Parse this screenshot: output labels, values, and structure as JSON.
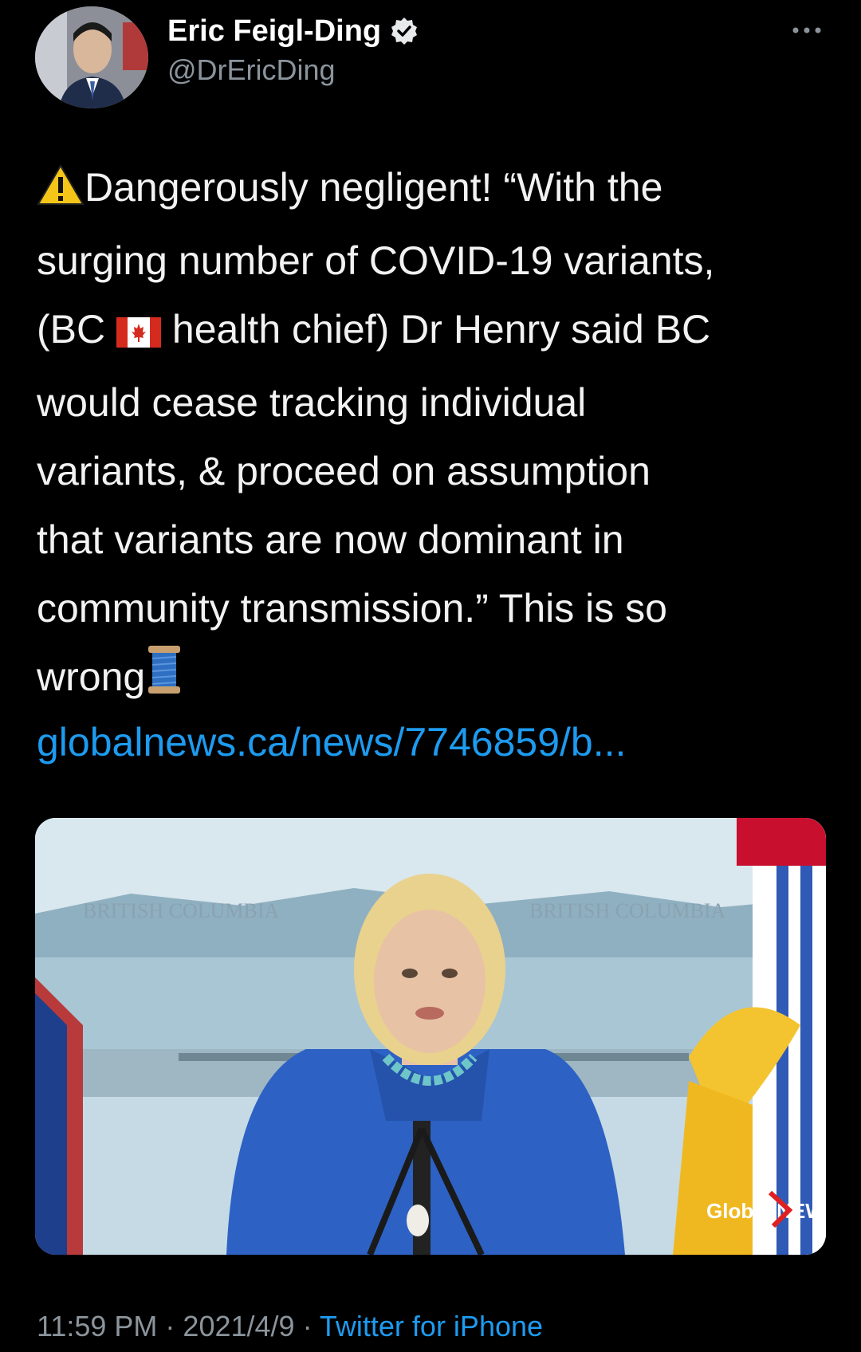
{
  "author": {
    "name": "Eric Feigl-Ding",
    "handle": "@DrEricDing",
    "verified": true
  },
  "tweet": {
    "line1": "Dangerously negligent! “With the",
    "line2": "surging number of COVID-19 variants,",
    "line3a": "(BC ",
    "line3b": " health chief) Dr Henry said BC",
    "line4": "would cease tracking individual",
    "line5": "variants, & proceed on assumption",
    "line6": "that variants are now dominant in",
    "line7": "community transmission.” This is so",
    "line8": "wrong",
    "link": "globalnews.ca/news/7746859/b..."
  },
  "media": {
    "watermark": "Global NEWS",
    "backdrop_text": "BRITISH COLUMBIA"
  },
  "meta": {
    "time": "11:59 PM",
    "separator": " · ",
    "date": "2021/4/9",
    "source": "Twitter for iPhone"
  },
  "icons": {
    "warning": "warning-icon",
    "flag": "canada-flag-icon",
    "thread": "thread-spool-icon",
    "verified": "verified-badge-icon",
    "more": "more-icon"
  },
  "colors": {
    "background": "#000000",
    "text": "#f2f2f2",
    "secondary": "#8b949c",
    "link": "#1d9bf0"
  }
}
